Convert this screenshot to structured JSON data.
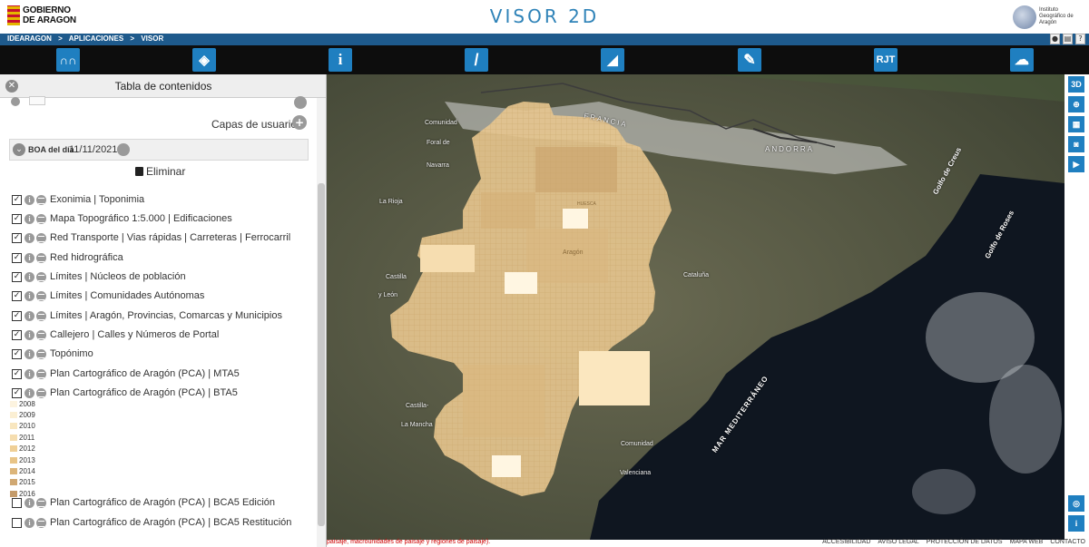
{
  "header": {
    "left_logo": [
      "GOBIERNO",
      "DE ARAGON"
    ],
    "title": "VISOR 2D",
    "right_logo": [
      "Instituto",
      "Geográfico de",
      "Aragón"
    ]
  },
  "breadcrumb": [
    "IDEARAGON",
    ">",
    "APLICACIONES",
    ">",
    "VISOR"
  ],
  "toolbar": {
    "tools": [
      {
        "name": "binoculars-icon",
        "glyph": "∩∩"
      },
      {
        "name": "layers-icon",
        "glyph": "◈"
      },
      {
        "name": "info-icon",
        "glyph": "i"
      },
      {
        "name": "ruler-icon",
        "glyph": "/"
      },
      {
        "name": "profile-icon",
        "glyph": "◢"
      },
      {
        "name": "pencil-icon",
        "glyph": "✎"
      },
      {
        "name": "rjt-button",
        "glyph": "RJT"
      },
      {
        "name": "weather-icon",
        "glyph": "☁"
      }
    ]
  },
  "sidebar": {
    "title": "Tabla de contenidos",
    "user_layers": "Capas de usuario",
    "boa_label": "BOA del día",
    "boa_date": "11/11/2021",
    "delete_label": "Eliminar",
    "layers": [
      {
        "label": "Exonimia | Toponimia",
        "checked": true
      },
      {
        "label": "Mapa Topográfico 1:5.000 | Edificaciones",
        "checked": true
      },
      {
        "label": "Red Transporte | Vias rápidas | Carreteras | Ferrocarril",
        "checked": true
      },
      {
        "label": "Red hidrográfica",
        "checked": true
      },
      {
        "label": "Límites | Núcleos de población",
        "checked": true
      },
      {
        "label": "Límites | Comunidades Autónomas",
        "checked": true
      },
      {
        "label": "Límites | Aragón, Provincias, Comarcas y Municipios",
        "checked": true
      },
      {
        "label": "Callejero | Calles y Números de Portal",
        "checked": true
      },
      {
        "label": "Topónimo",
        "checked": true
      },
      {
        "label": "Plan Cartográfico de Aragón (PCA) | MTA5",
        "checked": true
      },
      {
        "label": "Plan Cartográfico de Aragón (PCA) | BTA5",
        "checked": true
      }
    ],
    "legend": [
      {
        "year": "2008",
        "color": "#fcf3df"
      },
      {
        "year": "2009",
        "color": "#fbefd3"
      },
      {
        "year": "2010",
        "color": "#f8e6bf"
      },
      {
        "year": "2011",
        "color": "#f5ddaf"
      },
      {
        "year": "2012",
        "color": "#efcf96"
      },
      {
        "year": "2013",
        "color": "#e8c487"
      },
      {
        "year": "2014",
        "color": "#dcb57a"
      },
      {
        "year": "2015",
        "color": "#d0a872"
      },
      {
        "year": "2016",
        "color": "#c49b6a"
      }
    ],
    "bottom_layers": [
      {
        "label": "Plan Cartográfico de Aragón (PCA) | BCA5 Edición",
        "checked": false
      },
      {
        "label": "Plan Cartográfico de Aragón (PCA) | BCA5 Restitución",
        "checked": false
      }
    ]
  },
  "map": {
    "labels": [
      {
        "text": "Comunidad",
        "cls": "map-label"
      },
      {
        "text": "Foral de",
        "cls": "map-label"
      },
      {
        "text": "Navarra",
        "cls": "map-label"
      },
      {
        "text": "La Rioja",
        "cls": "map-label"
      },
      {
        "text": "Castilla",
        "cls": "map-label"
      },
      {
        "text": "y León",
        "cls": "map-label"
      },
      {
        "text": "Castilla-",
        "cls": "map-label"
      },
      {
        "text": "La Mancha",
        "cls": "map-label"
      },
      {
        "text": "Cataluña",
        "cls": "map-label"
      },
      {
        "text": "Comunidad",
        "cls": "map-label"
      },
      {
        "text": "Valenciana",
        "cls": "map-label"
      },
      {
        "text": "FRANCIA",
        "cls": "map-label"
      },
      {
        "text": "ANDORRA",
        "cls": "map-label"
      },
      {
        "text": "Aragón",
        "cls": "map-label"
      },
      {
        "text": "HUESCA",
        "cls": "map-label"
      }
    ],
    "sea_labels": [
      "Golfo de Creus",
      "Golfo de Roses",
      "MAR MEDITERRÁNEO"
    ]
  },
  "rightbar": {
    "buttons": [
      {
        "name": "3d-button",
        "glyph": "3D"
      },
      {
        "name": "compass-icon",
        "glyph": "⊕"
      },
      {
        "name": "grid-icon",
        "glyph": "▦"
      },
      {
        "name": "camera-icon",
        "glyph": "◙"
      },
      {
        "name": "video-icon",
        "glyph": "▶"
      },
      {
        "name": "locate-icon",
        "glyph": "◎"
      },
      {
        "name": "info-small-icon",
        "glyph": "i"
      }
    ]
  },
  "footer": {
    "note": "paisaje, macrounidades de paisaje y regiones de paisaje).",
    "links": [
      "ACCESIBILIDAD",
      "AVISO LEGAL",
      "PROTECCIÓN DE DATOS",
      "MAPA WEB",
      "CONTACTO"
    ]
  },
  "colors": {
    "accent": "#1f7fc0",
    "breadcrumb_bg": "#1e5a8c",
    "toolbar_bg": "#0d0d0d",
    "coverage_fill": "#e8c78f"
  }
}
